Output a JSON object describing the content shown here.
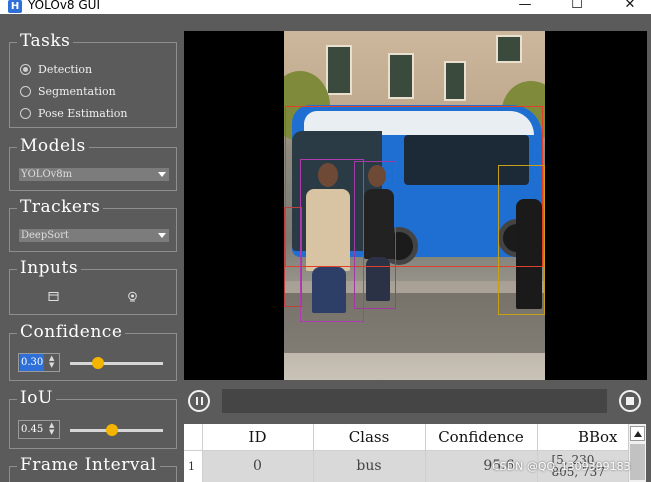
{
  "window": {
    "title": "YOLOv8 GUI",
    "app_icon_letter": "H",
    "minimize": "—",
    "maximize": "☐",
    "close": "✕"
  },
  "tasks": {
    "title": "Tasks",
    "options": [
      {
        "label": "Detection",
        "checked": true
      },
      {
        "label": "Segmentation",
        "checked": false
      },
      {
        "label": "Pose Estimation",
        "checked": false
      }
    ]
  },
  "models": {
    "title": "Models",
    "selected": "YOLOv8m"
  },
  "trackers": {
    "title": "Trackers",
    "selected": "DeepSort"
  },
  "inputs": {
    "title": "Inputs",
    "icons": [
      "image-file-icon",
      "camera-icon"
    ]
  },
  "confidence": {
    "title": "Confidence",
    "value": "0.30",
    "fraction": 0.3
  },
  "iou": {
    "title": "IoU",
    "value": "0.45",
    "fraction": 0.45
  },
  "frame_interval": {
    "title": "Frame Interval"
  },
  "playback": {
    "progress": 0.0
  },
  "results_table": {
    "columns": [
      "ID",
      "Class",
      "Confidence",
      "BBox"
    ],
    "rows": [
      {
        "row_number": "1",
        "id": "0",
        "class": "bus",
        "confidence": "95.6",
        "bbox": "[5, 230, 805, 737"
      }
    ]
  },
  "watermark": "CSDN @QQ_1309399183",
  "colors": {
    "background": "#5b5b5b",
    "selection": "#2f6fd8",
    "slider_handle": "#f4b400"
  }
}
